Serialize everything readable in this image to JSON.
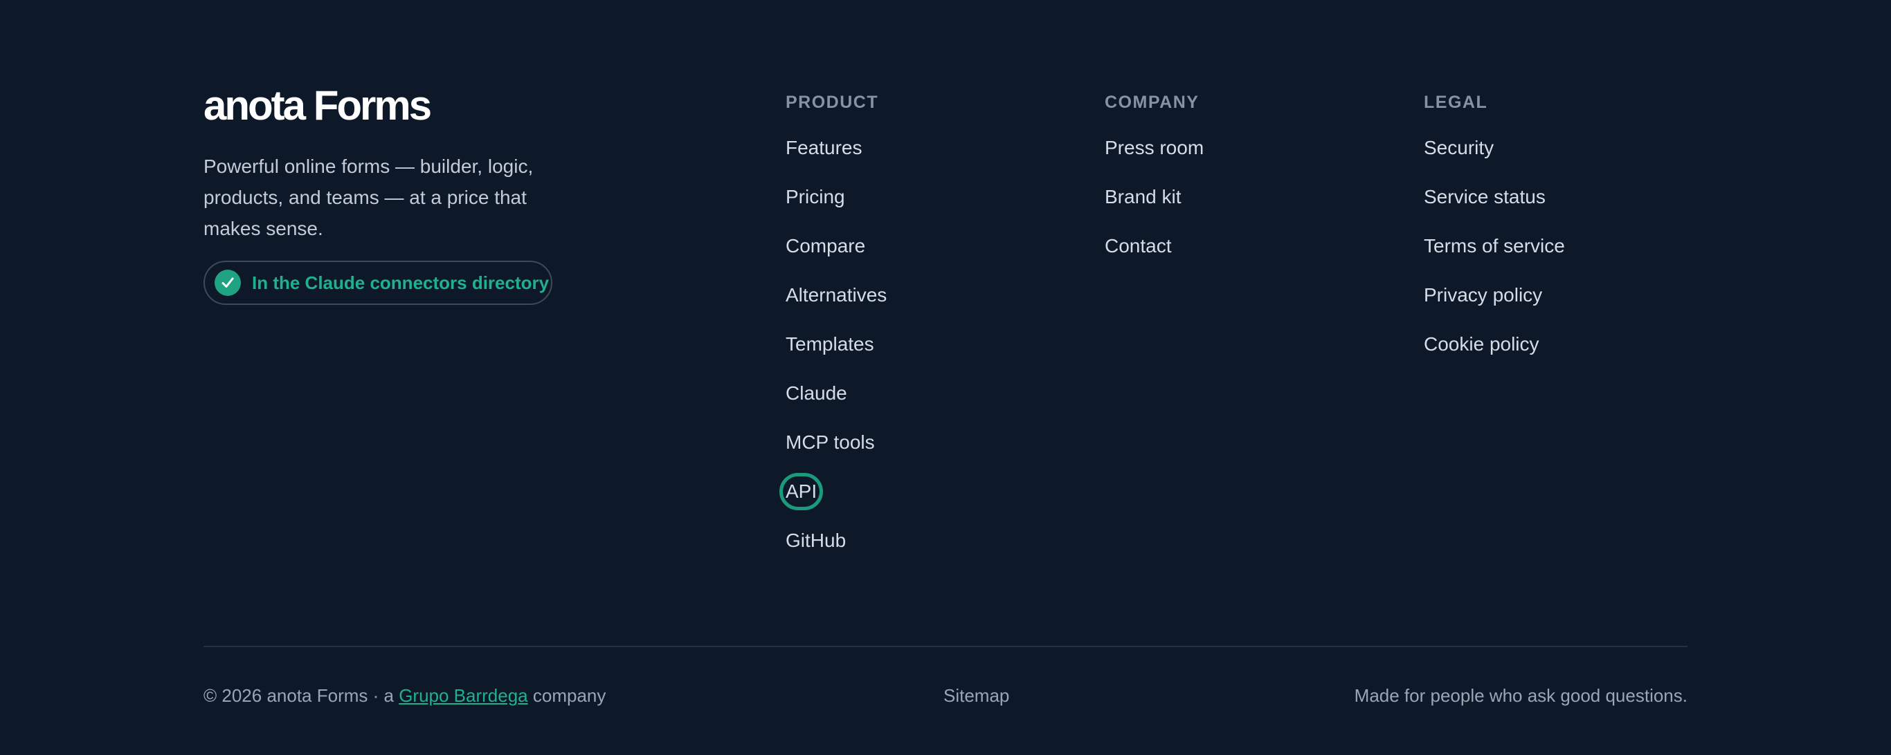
{
  "brand": {
    "logo": "anota Forms",
    "tagline": "Powerful online forms — builder, logic, products, and teams — at a price that makes sense.",
    "badge_label": "In the Claude connectors directory",
    "badge_icon": "checkmark-icon",
    "accent_color": "#1fa383"
  },
  "columns": {
    "product": {
      "heading": "PRODUCT",
      "items": [
        {
          "label": "Features"
        },
        {
          "label": "Pricing"
        },
        {
          "label": "Compare"
        },
        {
          "label": "Alternatives"
        },
        {
          "label": "Templates"
        },
        {
          "label": "Claude"
        },
        {
          "label": "MCP tools"
        },
        {
          "label": "API",
          "focused": true
        },
        {
          "label": "GitHub"
        }
      ]
    },
    "company": {
      "heading": "COMPANY",
      "items": [
        {
          "label": "Press room"
        },
        {
          "label": "Brand kit"
        },
        {
          "label": "Contact"
        }
      ]
    },
    "legal": {
      "heading": "LEGAL",
      "items": [
        {
          "label": "Security"
        },
        {
          "label": "Service status"
        },
        {
          "label": "Terms of service"
        },
        {
          "label": "Privacy policy"
        },
        {
          "label": "Cookie policy"
        }
      ]
    }
  },
  "bottom": {
    "copyright_prefix": "© 2026 anota Forms · a ",
    "company_link": "Grupo Barrdega",
    "copyright_suffix": " company",
    "sitemap": "Sitemap",
    "motto": "Made for people who ask good questions."
  },
  "colors": {
    "background": "#0d1929",
    "accent": "#21b08e",
    "focus_ring": "#1b9a7c"
  }
}
